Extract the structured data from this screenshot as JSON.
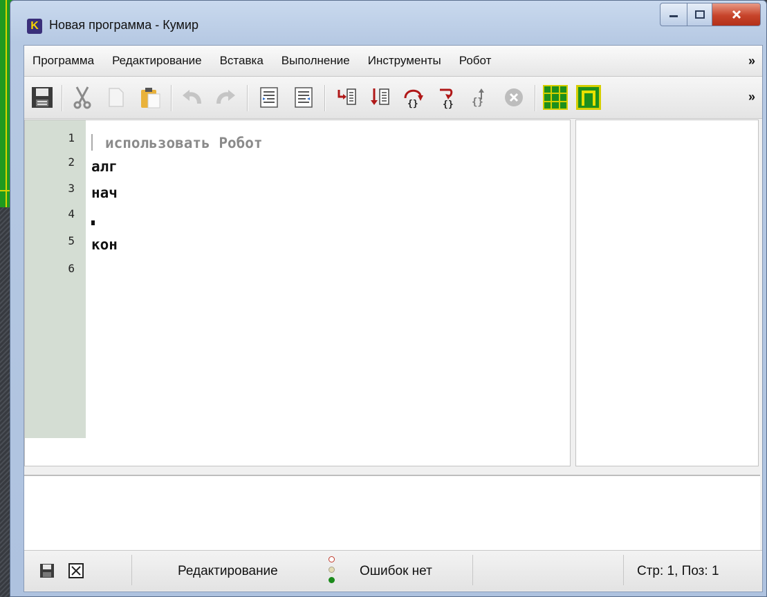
{
  "window": {
    "title": "Новая программа - Кумир",
    "app_icon_letter": "K"
  },
  "menubar": {
    "items": [
      "Программа",
      "Редактирование",
      "Вставка",
      "Выполнение",
      "Инструменты",
      "Робот"
    ],
    "more": "»"
  },
  "toolbar": {
    "buttons": [
      {
        "icon": "save-icon"
      },
      {
        "icon": "cut-icon"
      },
      {
        "icon": "copy-icon"
      },
      {
        "icon": "paste-icon"
      },
      {
        "icon": "undo-icon"
      },
      {
        "icon": "redo-icon"
      },
      {
        "icon": "insert-line-icon"
      },
      {
        "icon": "remove-line-icon"
      },
      {
        "icon": "run-icon"
      },
      {
        "icon": "step-run-icon"
      },
      {
        "icon": "step-over-icon"
      },
      {
        "icon": "step-into-icon"
      },
      {
        "icon": "step-out-icon"
      },
      {
        "icon": "stop-icon"
      },
      {
        "icon": "robot-grid-icon"
      },
      {
        "icon": "robot-field-icon"
      }
    ],
    "more": "»"
  },
  "editor": {
    "line_numbers": [
      "1",
      "2",
      "3",
      "4",
      "5",
      "6"
    ],
    "lines": [
      "использовать Робот",
      "алг",
      "нач",
      "",
      "кон",
      ""
    ]
  },
  "statusbar": {
    "mode": "Редактирование",
    "errors": "Ошибок нет",
    "position": "Стр: 1, Поз: 1"
  },
  "colors": {
    "gutter": "#d4ddd3",
    "close_button": "#c7442a",
    "title_bar": "#c9d9ee"
  }
}
